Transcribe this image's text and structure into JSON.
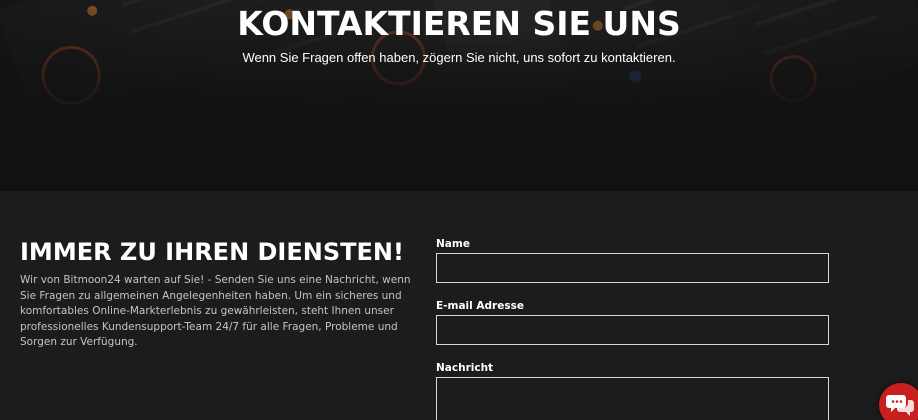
{
  "hero": {
    "title": "KONTAKTIEREN SIE UNS",
    "subtitle": "Wenn Sie Fragen offen haben, zögern Sie nicht, uns sofort zu kontaktieren."
  },
  "intro": {
    "title": "IMMER ZU IHREN DIENSTEN!",
    "text": "Wir von Bitmoon24 warten auf Sie! - Senden Sie uns eine Nachricht, wenn Sie Fragen zu allgemeinen Angelegenheiten haben. Um ein sicheres und komfortables Online-Markterlebnis zu gewährleisten, steht Ihnen unser professionelles Kundensupport-Team 24/7 für alle Fragen, Probleme und Sorgen zur Verfügung."
  },
  "form": {
    "name_label": "Name",
    "name_value": "",
    "email_label": "E-mail Adresse",
    "email_value": "",
    "message_label": "Nachricht",
    "message_value": ""
  },
  "chat_widget": {
    "icon": "chat-bubbles-icon",
    "color": "#c8201e"
  },
  "colors": {
    "hero_background": "#111111",
    "content_background": "#1c1c1c",
    "body_text": "#c4c4c4",
    "input_border": "#d8d8d8"
  }
}
